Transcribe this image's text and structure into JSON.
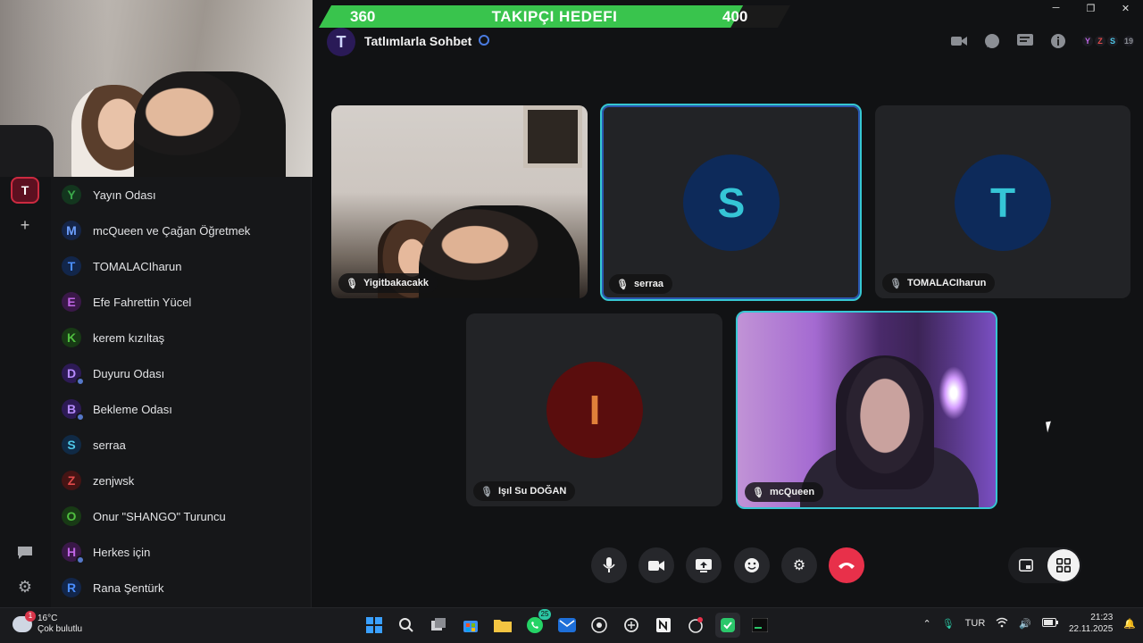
{
  "follower_goal": {
    "current": "360",
    "title": "TAKIPÇI HEDEFI",
    "target": "400",
    "progress_fraction": 0.9
  },
  "window_controls": {
    "minimize": "─",
    "maximize": "❐",
    "close": "✕"
  },
  "header": {
    "channel_avatar_letter": "T",
    "channel_title": "Tatlımlarla Sohbet",
    "member_avatars": [
      "Y",
      "Z",
      "S"
    ],
    "member_count": "19"
  },
  "rail": {
    "server_letter": "T",
    "add_label": "+"
  },
  "channels": [
    {
      "letter": "Y",
      "name": "Yayın Odası",
      "color": "#3aa84a",
      "bg": "#13361e",
      "globe": false
    },
    {
      "letter": "M",
      "name": "mcQueen ve Çağan Öğretmek",
      "color": "#6ea0ff",
      "bg": "#152548",
      "globe": false
    },
    {
      "letter": "T",
      "name": "TOMALACIharun",
      "color": "#4a8eff",
      "bg": "#12264a",
      "globe": false
    },
    {
      "letter": "E",
      "name": "Efe Fahrettin Yücel",
      "color": "#c066e6",
      "bg": "#3a1848",
      "globe": false
    },
    {
      "letter": "K",
      "name": "kerem kızıltaş",
      "color": "#50c040",
      "bg": "#183a15",
      "globe": false
    },
    {
      "letter": "D",
      "name": "Duyuru Odası",
      "color": "#b78cff",
      "bg": "#2d1a55",
      "globe": true
    },
    {
      "letter": "B",
      "name": "Bekleme Odası",
      "color": "#b78cff",
      "bg": "#2d1a55",
      "globe": true
    },
    {
      "letter": "S",
      "name": "serraa",
      "color": "#4ec7e8",
      "bg": "#102a45",
      "globe": false
    },
    {
      "letter": "Z",
      "name": "zenjwsk",
      "color": "#e04a4a",
      "bg": "#451414",
      "globe": false
    },
    {
      "letter": "O",
      "name": "Onur \"SHANGO\" Turuncu",
      "color": "#50c040",
      "bg": "#183a15",
      "globe": false
    },
    {
      "letter": "H",
      "name": "Herkes için",
      "color": "#c066e6",
      "bg": "#3a1848",
      "globe": true
    },
    {
      "letter": "R",
      "name": "Rana Şentürk",
      "color": "#4a8eff",
      "bg": "#12264a",
      "globe": false
    }
  ],
  "tiles": [
    {
      "name": "Yigitbakacakk",
      "type": "video",
      "muted": false,
      "active": false
    },
    {
      "name": "serraa",
      "type": "avatar",
      "letter": "S",
      "letter_color": "#35c5d6",
      "avatar_bg": "#0d2a5a",
      "muted": false,
      "active": true
    },
    {
      "name": "TOMALACIharun",
      "type": "avatar",
      "letter": "T",
      "letter_color": "#35c5d6",
      "avatar_bg": "#0d2a5a",
      "muted": true,
      "active": false
    },
    {
      "name": "Işıl Su DOĞAN",
      "type": "avatar",
      "letter": "I",
      "letter_color": "#e0803a",
      "avatar_bg": "#5a0d0d",
      "muted": true,
      "active": false
    },
    {
      "name": "mcQueen",
      "type": "video",
      "muted": false,
      "active": true
    }
  ],
  "controls": {
    "mic": "🎤",
    "camera": "■",
    "screenshare": "⇪",
    "emoji": "☺",
    "settings": "⚙",
    "hangup": "☎"
  },
  "taskbar": {
    "temperature": "16°C",
    "weather": "Çok bulutlu",
    "weather_badge": "1",
    "whatsapp_badge": "25",
    "language": "TUR",
    "time": "21:23",
    "date": "22.11.2025"
  }
}
